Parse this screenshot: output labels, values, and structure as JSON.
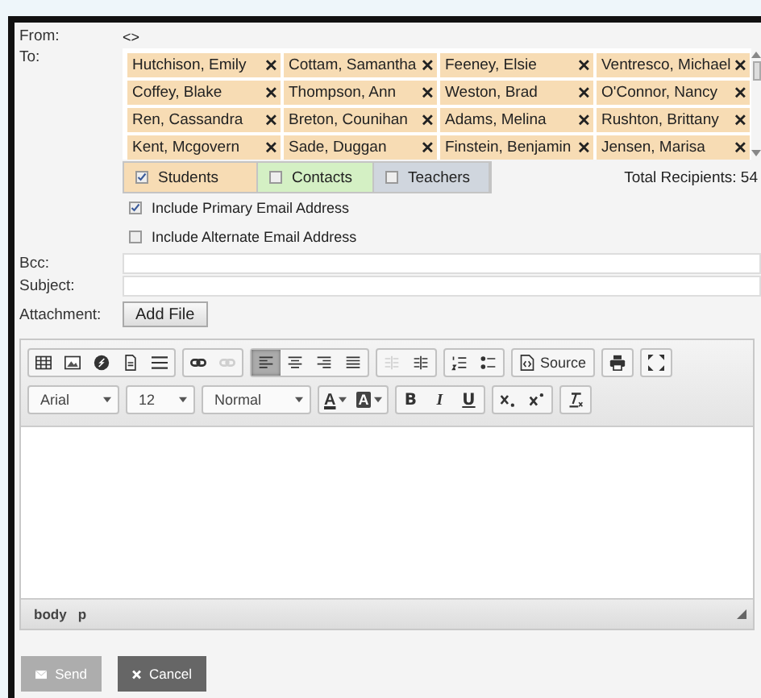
{
  "from": {
    "label": "From:",
    "value": "<>"
  },
  "to": {
    "label": "To:",
    "recipients": [
      {
        "name": "Hutchison, Emily",
        "remove": "✕"
      },
      {
        "name": "Cottam, Samantha",
        "remove": "✕"
      },
      {
        "name": "Feeney, Elsie",
        "remove": "✕"
      },
      {
        "name": "Ventresco, Michael",
        "remove": "✕"
      },
      {
        "name": "Coffey, Blake",
        "remove": "✕"
      },
      {
        "name": "Thompson, Ann",
        "remove": "✕"
      },
      {
        "name": "Weston, Brad",
        "remove": "✕"
      },
      {
        "name": "O'Connor, Nancy",
        "remove": "✕"
      },
      {
        "name": "Ren, Cassandra",
        "remove": "✕"
      },
      {
        "name": "Breton, Counihan",
        "remove": "✕"
      },
      {
        "name": "Adams, Melina",
        "remove": "✕"
      },
      {
        "name": "Rushton, Brittany",
        "remove": "✕"
      },
      {
        "name": "Kent, Mcgovern",
        "remove": "✕"
      },
      {
        "name": "Sade, Duggan",
        "remove": "✕"
      },
      {
        "name": "Finstein, Benjamin",
        "remove": "✕"
      },
      {
        "name": "Jensen, Marisa",
        "remove": "✕"
      }
    ]
  },
  "filters": [
    {
      "label": "Students",
      "checked": true,
      "color": "#f7dcb4"
    },
    {
      "label": "Contacts",
      "checked": false,
      "color": "#d4f0c4"
    },
    {
      "label": "Teachers",
      "checked": false,
      "color": "#d0d6de"
    }
  ],
  "total_recipients": "Total Recipients: 54",
  "options": [
    {
      "label": "Include Primary Email Address",
      "checked": true
    },
    {
      "label": "Include Alternate Email Address",
      "checked": false
    }
  ],
  "bcc": {
    "label": "Bcc:"
  },
  "subject": {
    "label": "Subject:"
  },
  "attachment": {
    "label": "Attachment:",
    "button": "Add File"
  },
  "toolbar": {
    "row1": [
      [
        {
          "kind": "table",
          "disabled": false
        },
        {
          "kind": "image",
          "disabled": false
        },
        {
          "kind": "flash",
          "disabled": false
        },
        {
          "kind": "page",
          "disabled": false
        },
        {
          "kind": "rule",
          "disabled": false
        }
      ],
      [
        {
          "kind": "link",
          "disabled": false
        },
        {
          "kind": "unlink",
          "disabled": true
        }
      ],
      [
        {
          "kind": "align-left",
          "disabled": false
        },
        {
          "kind": "align-center",
          "disabled": false
        },
        {
          "kind": "align-right",
          "disabled": false
        },
        {
          "kind": "justify",
          "disabled": false
        }
      ],
      [
        {
          "kind": "outdent",
          "disabled": true
        },
        {
          "kind": "indent",
          "disabled": false
        }
      ],
      [
        {
          "kind": "numbered-list",
          "disabled": false
        },
        {
          "kind": "bulleted-list",
          "disabled": false
        }
      ],
      [
        {
          "kind": "source",
          "disabled": false,
          "label": "Source"
        }
      ],
      [
        {
          "kind": "print",
          "disabled": false
        }
      ],
      [
        {
          "kind": "maximize",
          "disabled": false
        }
      ]
    ],
    "align_selected": [
      true,
      false,
      false,
      false
    ],
    "font": "Arial",
    "size": "12",
    "format": "Normal",
    "colors": [
      {
        "letter": "A",
        "kind": "text"
      },
      {
        "letter": "A",
        "kind": "background"
      }
    ],
    "styles": [
      {
        "letter": "B",
        "kind": "bold"
      },
      {
        "letter": "I",
        "kind": "italic"
      },
      {
        "letter": "U",
        "kind": "underline"
      }
    ]
  },
  "editor_path": [
    "body",
    "p"
  ],
  "send": {
    "label": "Send",
    "disabled": true
  },
  "cancel": {
    "label": "Cancel"
  }
}
